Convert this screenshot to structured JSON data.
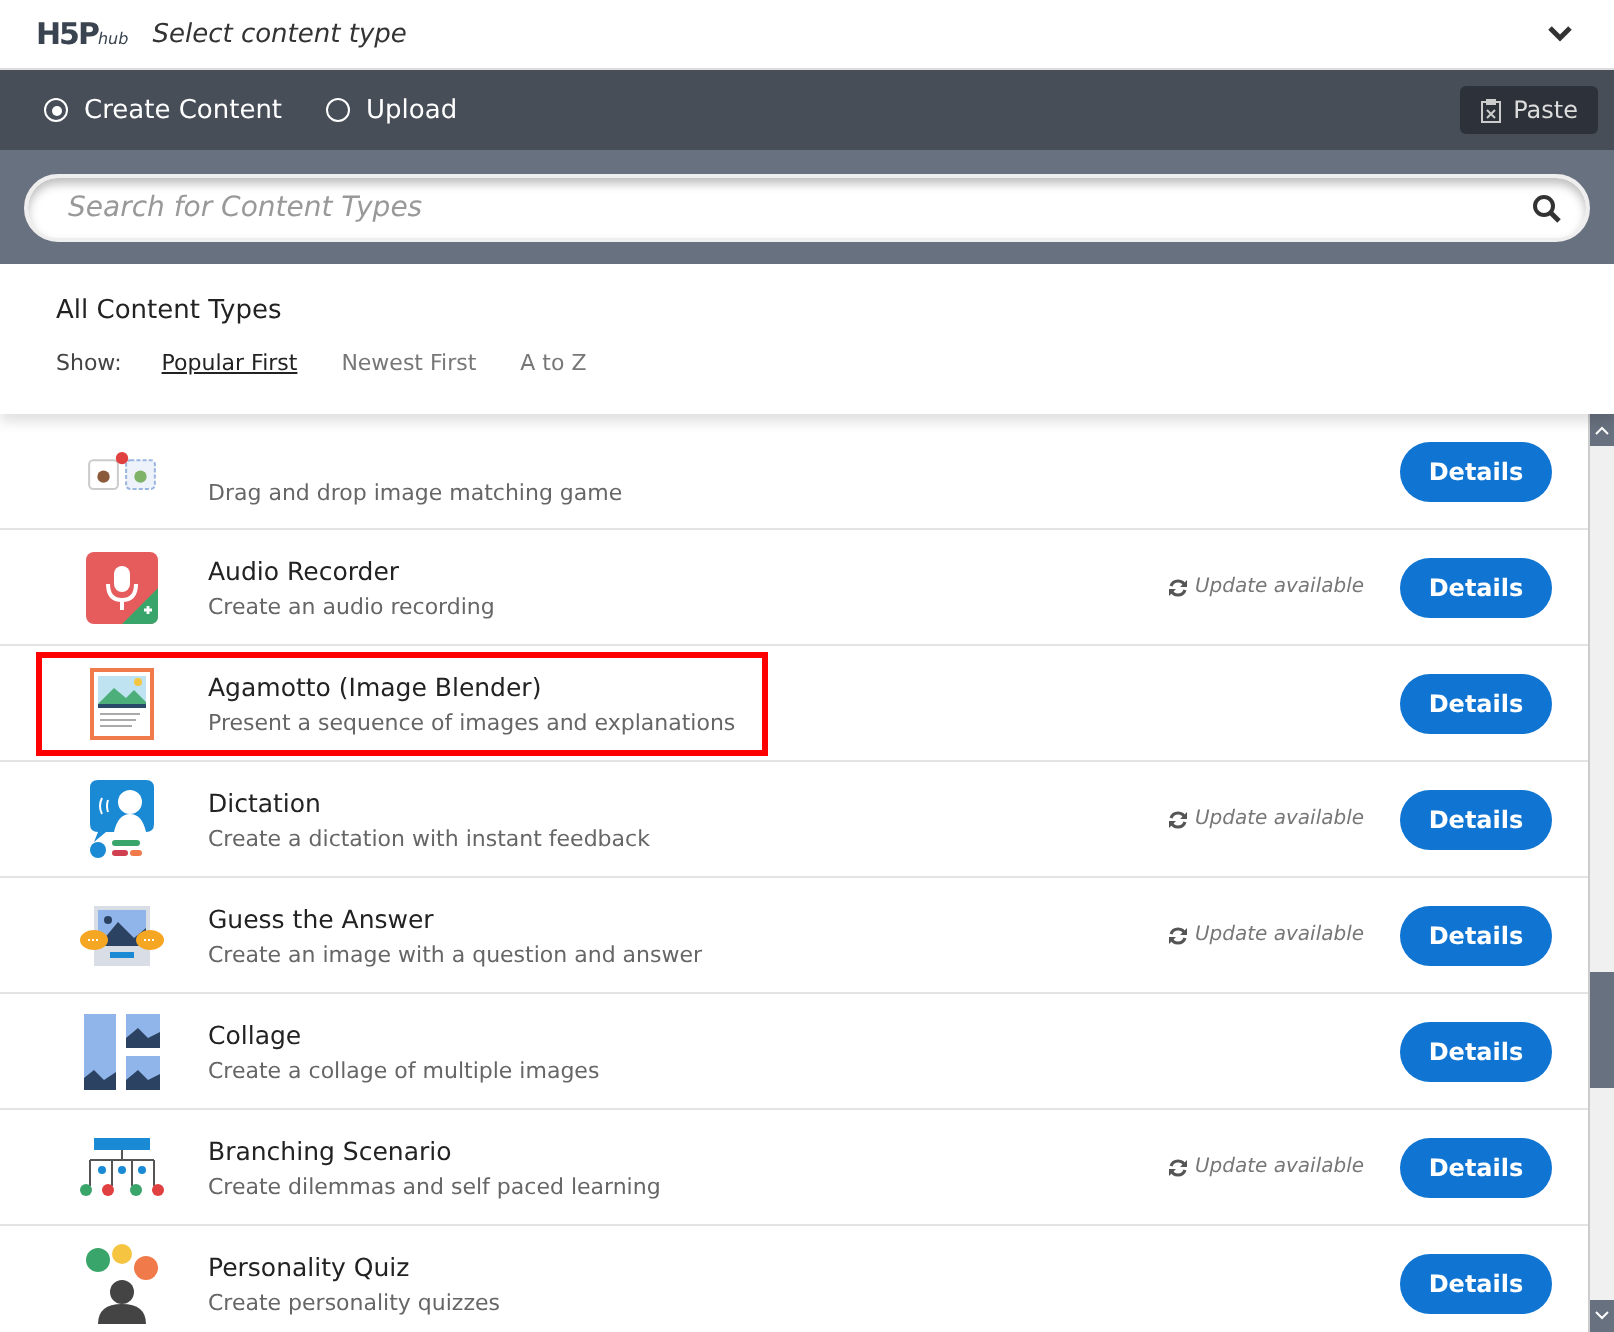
{
  "header": {
    "logo": "H5P",
    "logo_suffix": "hub",
    "title": "Select content type"
  },
  "modes": [
    {
      "label": "Create Content",
      "selected": true
    },
    {
      "label": "Upload",
      "selected": false
    }
  ],
  "paste_button": "Paste",
  "search": {
    "placeholder": "Search for Content Types"
  },
  "section_title": "All Content Types",
  "sort": {
    "label": "Show:",
    "options": [
      {
        "label": "Popular First",
        "selected": true
      },
      {
        "label": "Newest First",
        "selected": false
      },
      {
        "label": "A to Z",
        "selected": false
      }
    ]
  },
  "items": [
    {
      "description": "Drag and drop image matching game",
      "button": "Details",
      "highlighted": false
    },
    {
      "title": "Audio Recorder",
      "description": "Create an audio recording",
      "update": "Update available",
      "button": "Details",
      "highlighted": false
    },
    {
      "title": "Agamotto (Image Blender)",
      "description": "Present a sequence of images and explanations",
      "button": "Details",
      "highlighted": true
    },
    {
      "title": "Dictation",
      "description": "Create a dictation with instant feedback",
      "update": "Update available",
      "button": "Details",
      "highlighted": false
    },
    {
      "title": "Guess the Answer",
      "description": "Create an image with a question and answer",
      "update": "Update available",
      "button": "Details",
      "highlighted": false
    },
    {
      "title": "Collage",
      "description": "Create a collage of multiple images",
      "button": "Details",
      "highlighted": false
    },
    {
      "title": "Branching Scenario",
      "description": "Create dilemmas and self paced learning",
      "update": "Update available",
      "button": "Details",
      "highlighted": false
    },
    {
      "title": "Personality Quiz",
      "description": "Create personality quizzes",
      "button": "Details",
      "highlighted": false
    }
  ]
}
